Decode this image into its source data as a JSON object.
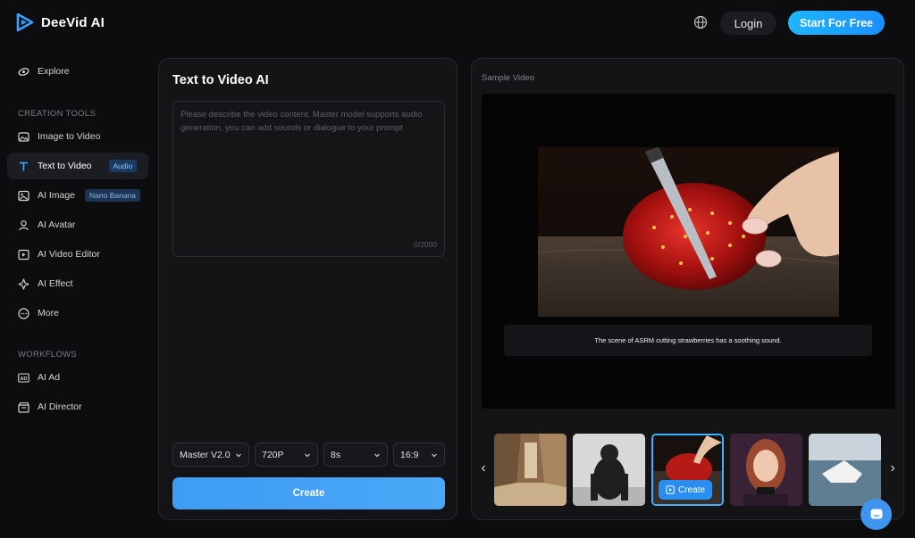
{
  "brand": {
    "name": "DeeVid AI",
    "accent": "#1fb6ff"
  },
  "header": {
    "language_icon": "globe-icon",
    "login_label": "Login",
    "start_label": "Start For Free"
  },
  "sidebar": {
    "explore": {
      "label": "Explore",
      "icon": "compass-icon"
    },
    "creation_tools_title": "CREATION TOOLS",
    "creation_tools": [
      {
        "label": "Image to Video",
        "icon": "image-icon"
      },
      {
        "label": "Text to Video",
        "icon": "text-icon",
        "badge": "Audio",
        "active": true
      },
      {
        "label": "AI Image",
        "icon": "picture-icon",
        "badge": "Nano Banana"
      },
      {
        "label": "AI Avatar",
        "icon": "user-icon"
      },
      {
        "label": "AI Video Editor",
        "icon": "video-edit-icon"
      },
      {
        "label": "AI Effect",
        "icon": "sparkle-icon"
      },
      {
        "label": "More",
        "icon": "more-icon"
      }
    ],
    "workflows_title": "WORKFLOWS",
    "workflows": [
      {
        "label": "AI Ad",
        "icon": "ad-icon"
      },
      {
        "label": "AI Director",
        "icon": "director-icon"
      }
    ]
  },
  "main": {
    "title": "Text to Video AI",
    "prompt_placeholder": "Please describe the video content. Master model supports audio generation, you can add sounds or dialogue to your prompt",
    "char_count": "0/2000",
    "options": {
      "model": "Master V2.0",
      "resolution": "720P",
      "duration": "8s",
      "ratio": "16:9"
    },
    "create_label": "Create"
  },
  "preview": {
    "label": "Sample Video",
    "caption": "The scene of ASRM cutting strawberries has a soothing sound.",
    "thumb_create_label": "Create",
    "thumbnails": [
      "alley-thumbnail",
      "gorilla-thumbnail",
      "strawberry-thumbnail",
      "woman-podcast-thumbnail",
      "paper-boat-thumbnail"
    ]
  },
  "chat_icon": "chat-icon"
}
